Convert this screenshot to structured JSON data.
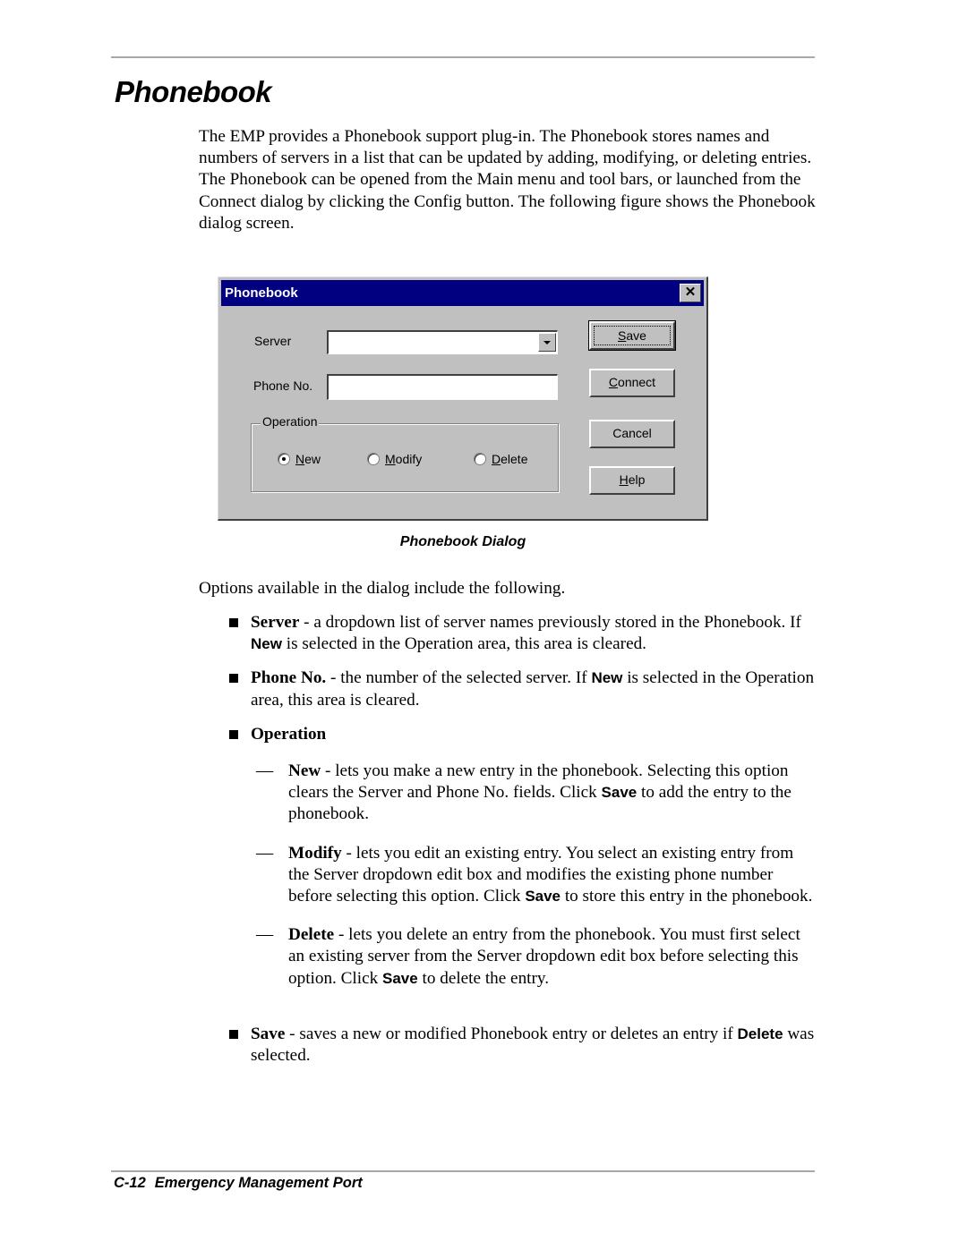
{
  "page": {
    "title": "Phonebook",
    "intro": "The EMP provides a Phonebook support plug-in. The Phonebook stores names and numbers of servers in a list that can be updated by adding, modifying, or deleting entries. The Phonebook can be opened from the Main menu and tool bars, or launched from the Connect dialog by clicking the Config button. The following figure shows the Phonebook dialog screen.",
    "figure_caption": "Phonebook Dialog",
    "options_intro": "Options available in the dialog include the following."
  },
  "dialog": {
    "title": "Phonebook",
    "close_glyph": "✕",
    "server_label": "Server",
    "server_value": "",
    "phone_label": "Phone No.",
    "phone_value": "",
    "operation_label": "Operation",
    "radios": [
      {
        "accel": "N",
        "rest": "ew",
        "selected": true
      },
      {
        "accel": "M",
        "rest": "odify",
        "selected": false
      },
      {
        "accel": "D",
        "rest": "elete",
        "selected": false
      }
    ],
    "buttons": [
      {
        "accel": "S",
        "rest": "ave"
      },
      {
        "accel": "C",
        "rest": "onnect"
      },
      {
        "accel": "",
        "rest": "Cancel"
      },
      {
        "accel": "H",
        "rest": "elp"
      }
    ]
  },
  "bullets": {
    "server": {
      "term": "Server",
      "pre": " - a dropdown list of server names previously stored in the Phonebook. If ",
      "em": "New",
      "post": " is selected in the Operation area, this area is cleared."
    },
    "phone": {
      "term": "Phone No.",
      "pre": " - the number of the selected server. If ",
      "em": "New",
      "post": " is selected in the Operation area, this area is cleared."
    },
    "operation": {
      "term": "Operation"
    },
    "save": {
      "term": "Save",
      "pre": " - saves a new or modified Phonebook entry or deletes an entry if ",
      "em": "Delete",
      "post": " was selected."
    }
  },
  "sub_bullets": {
    "dash": "—",
    "new": {
      "term": "New",
      "pre": " - lets you make a new entry in the phonebook. Selecting this option clears the Server and Phone No. fields. Click ",
      "em": "Save",
      "post": " to add the entry to the phonebook."
    },
    "modify": {
      "term": "Modify",
      "pre": " - lets you edit an existing entry. You select an existing entry from the Server dropdown edit box and modifies the existing phone number before selecting this option. Click ",
      "em": "Save",
      "post": " to store this entry in the phonebook."
    },
    "delete": {
      "term": "Delete",
      "pre": " - lets you delete an entry from the phonebook. You must first select an existing server from the Server dropdown edit box before selecting this option. Click ",
      "em": "Save",
      "post": " to delete the entry."
    }
  },
  "footer": {
    "page_number": "C-12",
    "section": "Emergency Management Port"
  }
}
